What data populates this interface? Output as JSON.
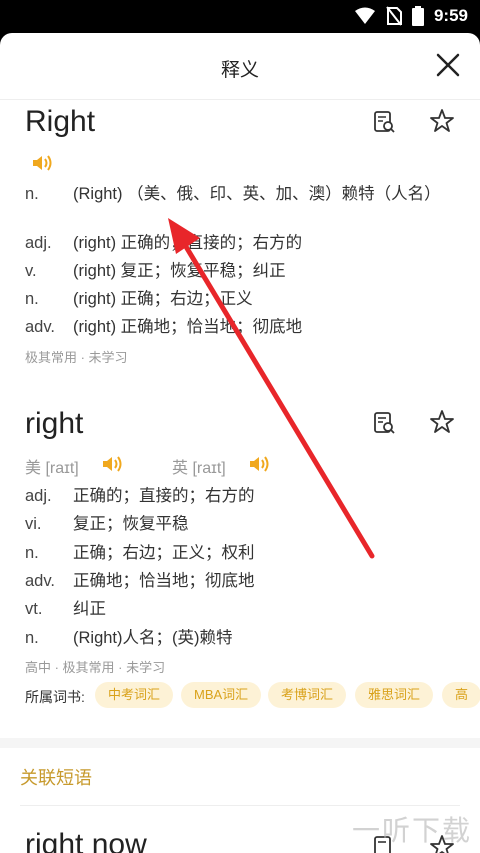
{
  "status": {
    "time": "9:59"
  },
  "header": {
    "title": "释义"
  },
  "entry1": {
    "word": "Right",
    "defs": [
      {
        "pos": "n.",
        "text": "(Right) （美、俄、印、英、加、澳）赖特（人名）"
      },
      {
        "pos": "adj.",
        "text": "(right) 正确的；直接的；右方的"
      },
      {
        "pos": "v.",
        "text": "(right) 复正；恢复平稳；纠正"
      },
      {
        "pos": "n.",
        "text": "(right) 正确；右边；正义"
      },
      {
        "pos": "adv.",
        "text": "(right) 正确地；恰当地；彻底地"
      }
    ],
    "meta": "极其常用 · 未学习"
  },
  "entry2": {
    "word": "right",
    "phonetic_us": "美 [raɪt]",
    "phonetic_uk": "英 [raɪt]",
    "defs": [
      {
        "pos": "adj.",
        "text": "正确的；直接的；右方的"
      },
      {
        "pos": "vi.",
        "text": "复正；恢复平稳"
      },
      {
        "pos": "n.",
        "text": "正确；右边；正义；权利"
      },
      {
        "pos": "adv.",
        "text": "正确地；恰当地；彻底地"
      },
      {
        "pos": "vt.",
        "text": "纠正"
      },
      {
        "pos": "n.",
        "text": "(Right)人名；(英)赖特"
      }
    ],
    "meta": "高中 · 极其常用 · 未学习",
    "books_label": "所属词书:",
    "books": [
      "中考词汇",
      "MBA词汇",
      "考博词汇",
      "雅思词汇",
      "高"
    ]
  },
  "related": {
    "title": "关联短语",
    "first_phrase": "right now"
  },
  "watermark": "一听下载",
  "colors": {
    "accent": "#f0a81e",
    "arrow": "#e8262a",
    "tag_bg": "#fdf2d6",
    "tag_text": "#d9a21b"
  },
  "icons": {
    "speaker": "speaker-icon",
    "detail": "detail-search-icon",
    "star": "star-icon",
    "close": "close-icon"
  }
}
